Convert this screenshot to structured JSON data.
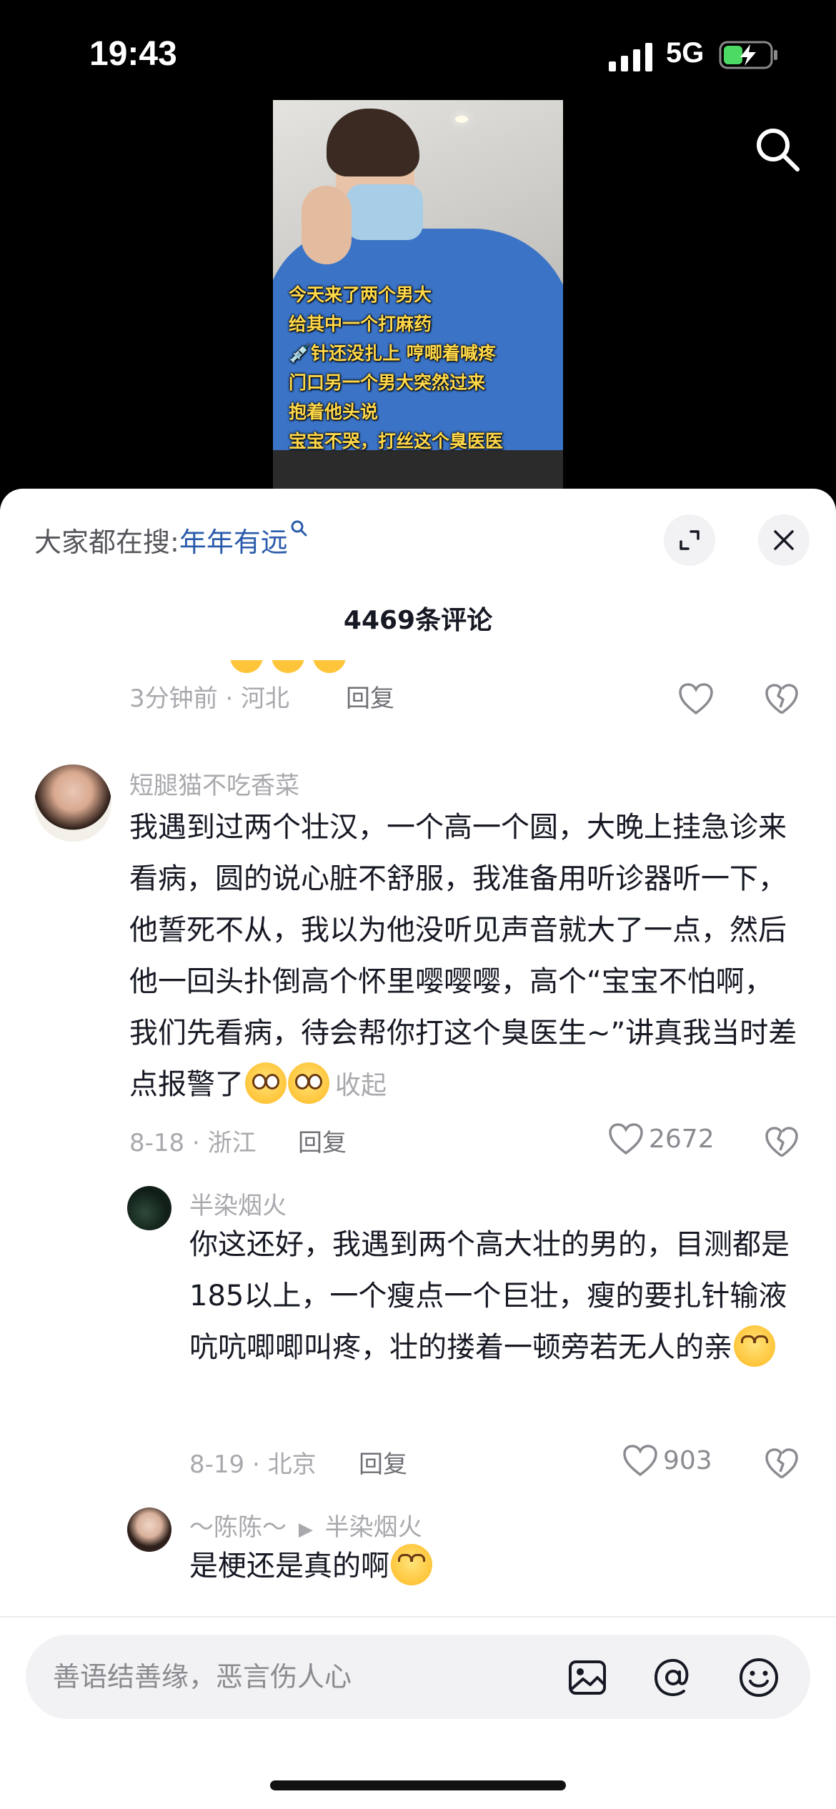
{
  "status": {
    "time": "19:43",
    "network": "5G"
  },
  "video": {
    "caption_lines": [
      "今天来了两个男大",
      "给其中一个打麻药",
      "💉针还没扎上 哼唧着喊疼",
      "门口另一个男大突然过来",
      "抱着他头说",
      "宝宝不哭，打丝这个臭医医"
    ]
  },
  "panel": {
    "search_prefix": "大家都在搜:",
    "search_keyword": "年年有远",
    "comment_count": "4469条评论"
  },
  "comments": [
    {
      "meta": "3分钟前 · 河北",
      "reply": "回复"
    },
    {
      "username": "短腿猫不吃香菜",
      "text": "我遇到过两个壮汉，一个高一个圆，大晚上挂急诊来看病，圆的说心脏不舒服，我准备用听诊器听一下，他誓死不从，我以为他没听见声音就大了一点，然后他一回头扑倒高个怀里嘤嘤嘤，高个“宝宝不怕啊，我们先看病，待会帮你打这个臭医生~”讲真我当时差点报警了",
      "collapse": "收起",
      "meta": "8-18 · 浙江",
      "reply": "回复",
      "likes": "2672"
    },
    {
      "username": "半染烟火",
      "text": "你这还好，我遇到两个高大壮的男的，目测都是185以上，一个瘦点一个巨壮，瘦的要扎针输液吭吭唧唧叫疼，壮的搂着一顿旁若无人的亲",
      "meta": "8-19 · 北京",
      "reply": "回复",
      "likes": "903"
    },
    {
      "username": "～陈陈～",
      "reply_to": "半染烟火",
      "text": "是梗还是真的啊"
    }
  ],
  "input": {
    "placeholder": "善语结善缘，恶言伤人心"
  },
  "icons": [
    "signal-icon",
    "battery-charging-icon",
    "search-icon",
    "expand-icon",
    "close-icon",
    "heart-icon",
    "dislike-heart-icon",
    "image-icon",
    "at-icon",
    "emoji-icon"
  ]
}
